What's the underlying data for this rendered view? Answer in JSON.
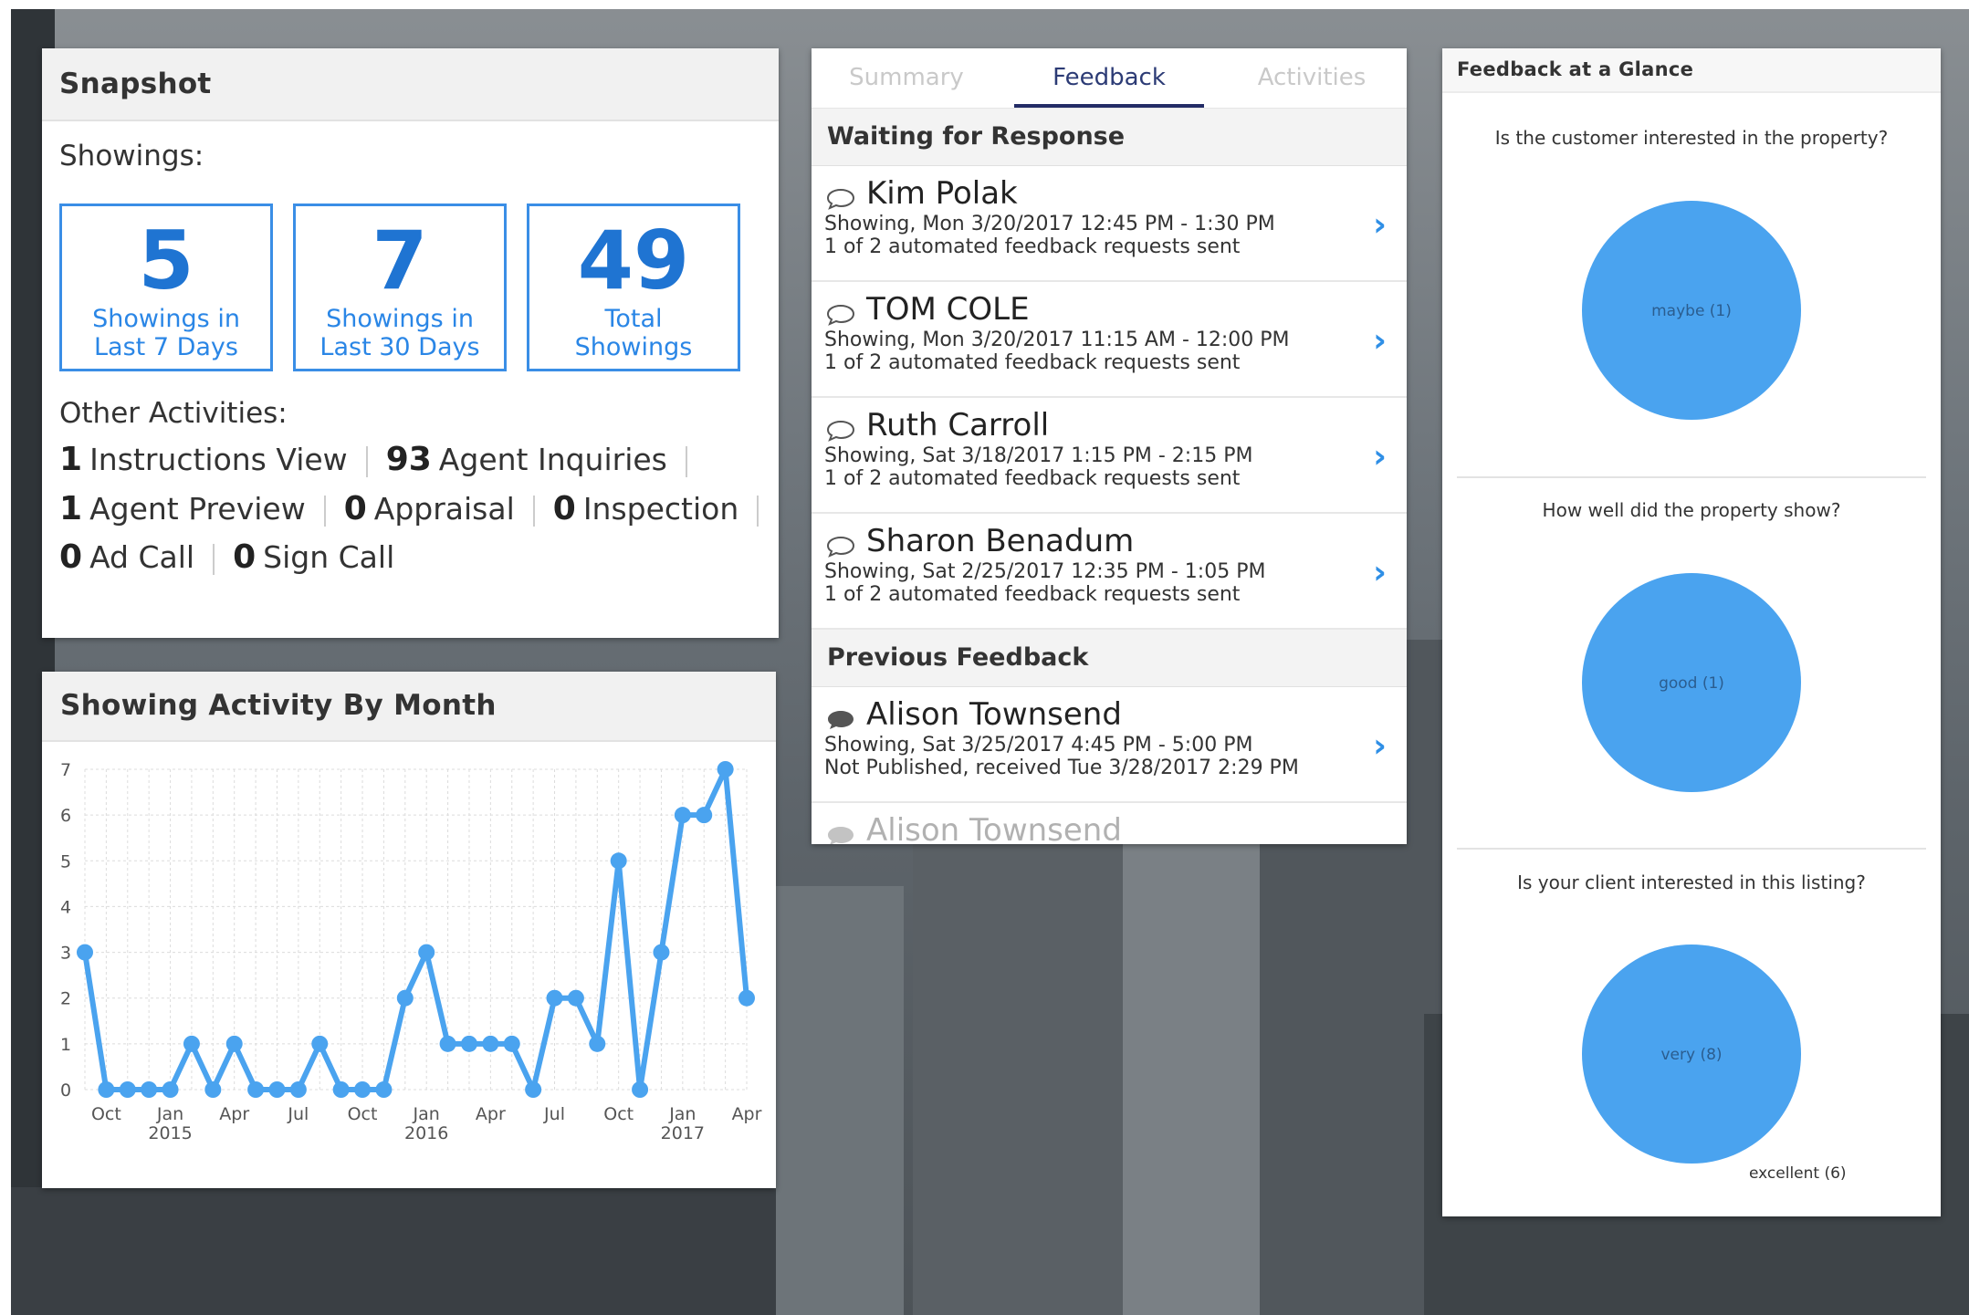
{
  "snapshot": {
    "title": "Snapshot",
    "showings_label": "Showings:",
    "stats": [
      {
        "value": "5",
        "caption1": "Showings in",
        "caption2": "Last 7 Days"
      },
      {
        "value": "7",
        "caption1": "Showings in",
        "caption2": "Last 30 Days"
      },
      {
        "value": "49",
        "caption1": "Total",
        "caption2": "Showings"
      }
    ],
    "other_label": "Other Activities:",
    "activities": [
      {
        "count": "1",
        "label": "Instructions View"
      },
      {
        "count": "93",
        "label": "Agent Inquiries"
      },
      {
        "count": "1",
        "label": "Agent Preview"
      },
      {
        "count": "0",
        "label": "Appraisal"
      },
      {
        "count": "0",
        "label": "Inspection"
      },
      {
        "count": "0",
        "label": "Ad Call"
      },
      {
        "count": "0",
        "label": "Sign Call"
      }
    ]
  },
  "activity_chart": {
    "title": "Showing Activity By Month"
  },
  "chart_data": {
    "type": "line",
    "title": "Showing Activity By Month",
    "xlabel": "",
    "ylabel": "",
    "ylim": [
      0,
      7
    ],
    "yticks": [
      0,
      1,
      2,
      3,
      4,
      5,
      6,
      7
    ],
    "grid": true,
    "x_tick_labels": [
      {
        "label": "Oct",
        "sub": ""
      },
      {
        "label": "Jan",
        "sub": "2015"
      },
      {
        "label": "Apr",
        "sub": ""
      },
      {
        "label": "Jul",
        "sub": ""
      },
      {
        "label": "Oct",
        "sub": ""
      },
      {
        "label": "Jan",
        "sub": "2016"
      },
      {
        "label": "Apr",
        "sub": ""
      },
      {
        "label": "Jul",
        "sub": ""
      },
      {
        "label": "Oct",
        "sub": ""
      },
      {
        "label": "Jan",
        "sub": "2017"
      },
      {
        "label": "Apr",
        "sub": ""
      }
    ],
    "months_start": "2014-09",
    "series": [
      {
        "color": "#4aa3ef",
        "values": [
          3,
          0,
          0,
          0,
          0,
          1,
          0,
          1,
          0,
          0,
          0,
          1,
          0,
          0,
          0,
          2,
          3,
          1,
          1,
          1,
          1,
          0,
          2,
          2,
          1,
          5,
          0,
          3,
          6,
          6,
          7,
          2
        ]
      }
    ]
  },
  "feedback_panel": {
    "tabs": [
      {
        "label": "Summary",
        "active": false
      },
      {
        "label": "Feedback",
        "active": true
      },
      {
        "label": "Activities",
        "active": false
      }
    ],
    "waiting_title": "Waiting for Response",
    "waiting": [
      {
        "name": "Kim Polak",
        "line1": "Showing, Mon 3/20/2017 12:45 PM - 1:30 PM",
        "line2": "1 of 2 automated feedback requests sent"
      },
      {
        "name": "TOM COLE",
        "line1": "Showing, Mon 3/20/2017 11:15 AM - 12:00 PM",
        "line2": "1 of 2 automated feedback requests sent"
      },
      {
        "name": "Ruth Carroll",
        "line1": "Showing, Sat 3/18/2017 1:15 PM - 2:15 PM",
        "line2": "1 of 2 automated feedback requests sent"
      },
      {
        "name": "Sharon Benadum",
        "line1": "Showing, Sat 2/25/2017 12:35 PM - 1:05 PM",
        "line2": "1 of 2 automated feedback requests sent"
      }
    ],
    "previous_title": "Previous Feedback",
    "previous": [
      {
        "name": "Alison Townsend",
        "line1": "Showing, Sat 3/25/2017 4:45 PM - 5:00 PM",
        "line2": "Not Published, received Tue 3/28/2017 2:29 PM"
      },
      {
        "name": "Alison Townsend",
        "line1": "",
        "line2": ""
      }
    ]
  },
  "glance": {
    "title": "Feedback at a Glance",
    "questions": [
      {
        "text": "Is the customer interested in the property?",
        "slices": [
          {
            "label": "maybe (1)",
            "value": 1
          }
        ]
      },
      {
        "text": "How well did the property show?",
        "slices": [
          {
            "label": "good (1)",
            "value": 1
          }
        ]
      },
      {
        "text": "Is your client interested in this listing?",
        "slices": [
          {
            "label": "very (8)",
            "value": 8
          },
          {
            "label": "excellent (6)",
            "value": 6
          }
        ]
      }
    ],
    "pie_color": "#4aa3ef"
  }
}
